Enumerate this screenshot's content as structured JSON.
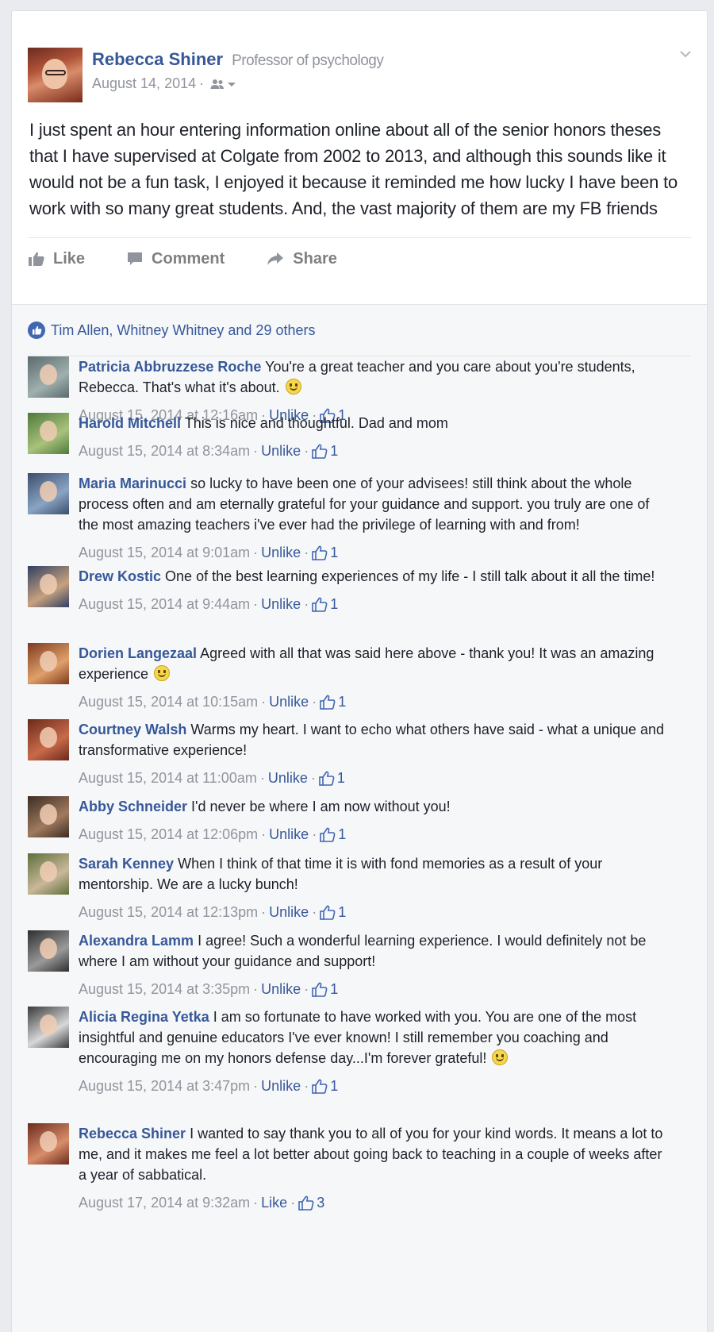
{
  "post": {
    "author": "Rebecca Shiner",
    "author_title": "Professor of psychology",
    "date": "August 14, 2014",
    "meta_separator": "·",
    "body": "I just spent an hour entering information online about all of the senior honors theses that I have supervised at Colgate from 2002 to 2013, and although this sounds like it would not be a fun task, I enjoyed it because it reminded me how lucky I have been to work with so many great students. And, the vast majority of them are my FB friends",
    "icons": {
      "audience": "friends-icon",
      "menu": "chevron-down-icon"
    }
  },
  "actions": {
    "like": "Like",
    "comment": "Comment",
    "share": "Share"
  },
  "likes_summary": "Tim Allen, Whitney Whitney and 29 others",
  "comments": [
    {
      "name": "Patricia Abbruzzese Roche",
      "text": "You're a great teacher and you care about you're students, Rebecca. That's what it's about.",
      "smiley": true,
      "time": "August 15, 2014 at 12:16am",
      "action": "Unlike",
      "likes": "1",
      "avatar_colors": [
        "#5a6a6e",
        "#9fb0ae"
      ]
    },
    {
      "name": "Harold Mitchell",
      "text": "This is nice and thoughtful. Dad and mom",
      "smiley": false,
      "time": "August 15, 2014 at 8:34am",
      "action": "Unlike",
      "likes": "1",
      "avatar_colors": [
        "#4e7a3c",
        "#a9c27c"
      ]
    },
    {
      "name": "Maria Marinucci",
      "text": "so lucky to have been one of your advisees! still think about the whole process often and am eternally grateful for your guidance and support. you truly are one of the most amazing teachers i've ever had the privilege of learning with and from!",
      "smiley": false,
      "time": "August 15, 2014 at 9:01am",
      "action": "Unlike",
      "likes": "1",
      "avatar_colors": [
        "#3b4e6b",
        "#8aa4c4"
      ]
    },
    {
      "name": "Drew Kostic",
      "text": "One of the best learning experiences of my life - I still talk about it all the time!",
      "smiley": false,
      "time": "August 15, 2014 at 9:44am",
      "action": "Unlike",
      "likes": "1",
      "avatar_colors": [
        "#2f3f63",
        "#c7a27e"
      ]
    },
    {
      "name": "Dorien Langezaal",
      "text": "Agreed with all that was said here above - thank you! It was an amazing experience",
      "smiley": true,
      "time": "August 15, 2014 at 10:15am",
      "action": "Unlike",
      "likes": "1",
      "avatar_colors": [
        "#7d3a1e",
        "#e0a06a"
      ]
    },
    {
      "name": "Courtney Walsh",
      "text": "Warms my heart. I want to echo what others have said - what a unique and transformative experience!",
      "smiley": false,
      "time": "August 15, 2014 at 11:00am",
      "action": "Unlike",
      "likes": "1",
      "avatar_colors": [
        "#6a2a1a",
        "#c96a4a"
      ]
    },
    {
      "name": "Abby Schneider",
      "text": "I'd never be where I am now without you!",
      "smiley": false,
      "time": "August 15, 2014 at 12:06pm",
      "action": "Unlike",
      "likes": "1",
      "avatar_colors": [
        "#3c2c24",
        "#a07a5e"
      ]
    },
    {
      "name": "Sarah Kenney",
      "text": "When I think of that time it is with fond memories as a result of your mentorship. We are a lucky bunch!",
      "smiley": false,
      "time": "August 15, 2014 at 12:13pm",
      "action": "Unlike",
      "likes": "1",
      "avatar_colors": [
        "#5e6f3a",
        "#c9b89a"
      ]
    },
    {
      "name": "Alexandra Lamm",
      "text": "I agree! Such a wonderful learning experience. I would definitely not be where I am without your guidance and support!",
      "smiley": false,
      "time": "August 15, 2014 at 3:35pm",
      "action": "Unlike",
      "likes": "1",
      "avatar_colors": [
        "#2e2e2e",
        "#9a9a9a"
      ]
    },
    {
      "name": "Alicia Regina Yetka",
      "text": "I am so fortunate to have worked with you. You are one of the most insightful and genuine educators I've ever known! I still remember you coaching and encouraging me on my honors defense day...I'm forever grateful!",
      "smiley": true,
      "time": "August 15, 2014 at 3:47pm",
      "action": "Unlike",
      "likes": "1",
      "avatar_colors": [
        "#3a3a3a",
        "#d8d8d8"
      ]
    },
    {
      "name": "Rebecca Shiner",
      "text": "I wanted to say thank you to all of you for your kind words. It means a lot to me, and it makes me feel a lot better about going back to teaching in a couple of weeks after a year of sabbatical.",
      "smiley": false,
      "time": "August 17, 2014 at 9:32am",
      "action": "Like",
      "likes": "3",
      "avatar_colors": [
        "#6b2b1e",
        "#d98d6a"
      ]
    }
  ]
}
